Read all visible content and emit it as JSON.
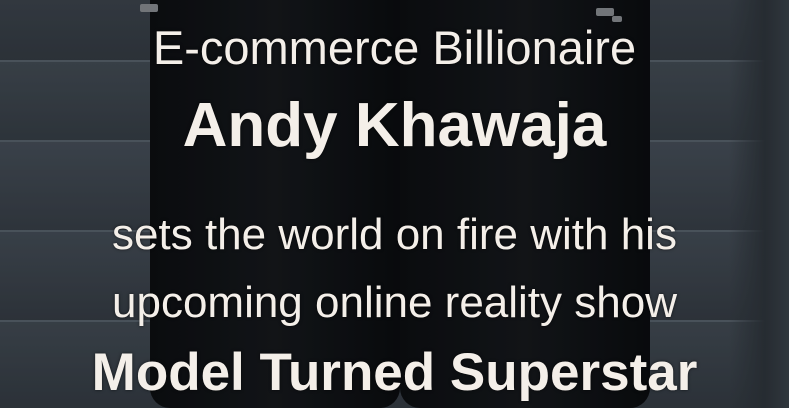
{
  "headline": {
    "line1": "E-commerce Billionaire",
    "line2": "Andy Khawaja",
    "line3": "sets the world on fire with his",
    "line4": "upcoming online reality show",
    "line5": "Model Turned Superstar"
  },
  "colors": {
    "text": "#f4efe9",
    "background": "#3a424a",
    "figure": "#111317"
  }
}
